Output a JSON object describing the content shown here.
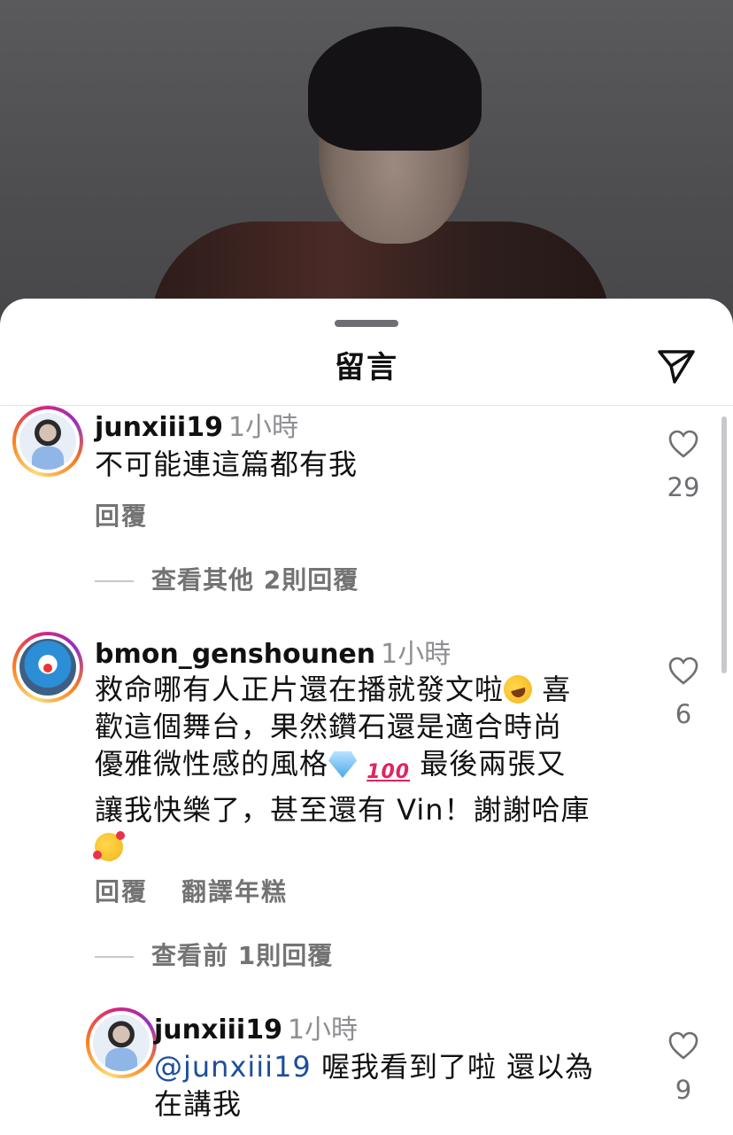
{
  "sheet": {
    "title": "留言"
  },
  "comments": [
    {
      "username": "junxiii19",
      "time": "1小時",
      "text": "不可能連這篇都有我",
      "reply_label": "回覆",
      "likes": "29",
      "view_replies": "查看其他 2則回覆"
    },
    {
      "username": "bmon_genshounen",
      "time": "1小時",
      "text_line1": "救命哪有人正片還在播就發文啦",
      "text_line1b": " 喜",
      "text_line2": "歡這個舞台，果然鑽石還是適合時尚",
      "text_line3": "優雅微性感的風格",
      "text_line3b": " 最後兩張又",
      "text_line4": "讓我快樂了，甚至還有 Vin！謝謝哈庫",
      "emoji_100": "100",
      "reply_label": "回覆",
      "translate_label": "翻譯年糕",
      "likes": "6",
      "view_replies": "查看前 1則回覆"
    },
    {
      "username": "junxiii19",
      "time": "1小時",
      "mention": "@junxiii19",
      "text_line1": " 喔我看到了啦 還以為",
      "text_line2": "在講我",
      "likes": "9"
    }
  ],
  "icons": {
    "send": "paper-plane-icon",
    "like": "heart-outline-icon"
  }
}
